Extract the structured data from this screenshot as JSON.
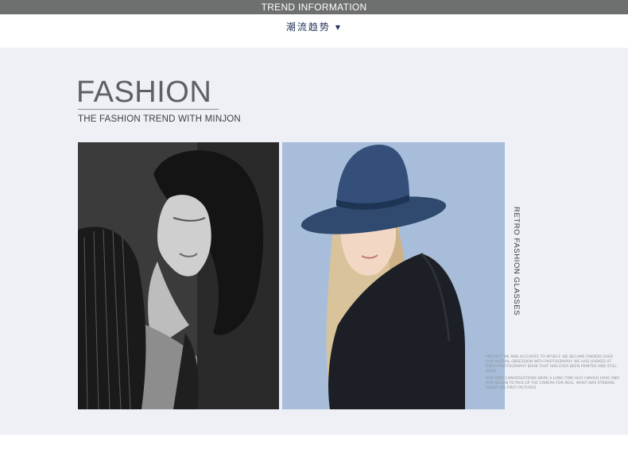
{
  "top_bar": {
    "title": "TREND INFORMATION"
  },
  "section_nav": {
    "title": "潮流趋势",
    "arrow": "▼"
  },
  "fashion": {
    "heading": "FASHION",
    "subheading": "THE FASHION TREND WITH MINJON",
    "side_label": "RETRO FASHION GLASSES",
    "paragraph_1": "PROTECT ME AND ACCURATE TO MYSELF. WE BECAME FRIENDS OVER OUR MUTUAL OBSESSION WITH PHOTOGRAPHY. WE HAD LOOKED AT EVERY PHOTOGRAPHY BOOK THAT HAD EVER BEEN PRINTED AND STILL DOES.",
    "paragraph_2": "OUR PAST CONVERSATIONS WERE A LONG TIME AGO I WHICH HAVE AND JUST BEGAN TO PICK UP THE CAMERA FOR REAL. WHAT WAS STRIKING ABOUT HIS FIRST PICTURES"
  },
  "photos": {
    "left_image": "black-and-white-portrait",
    "right_image": "woman-in-denim-hat"
  },
  "colors": {
    "top_bar": "#6e6f6f",
    "panel": "#eef0f5",
    "nav_text": "#1f2f57",
    "photo_blue_bg": "#a9bfdc"
  }
}
